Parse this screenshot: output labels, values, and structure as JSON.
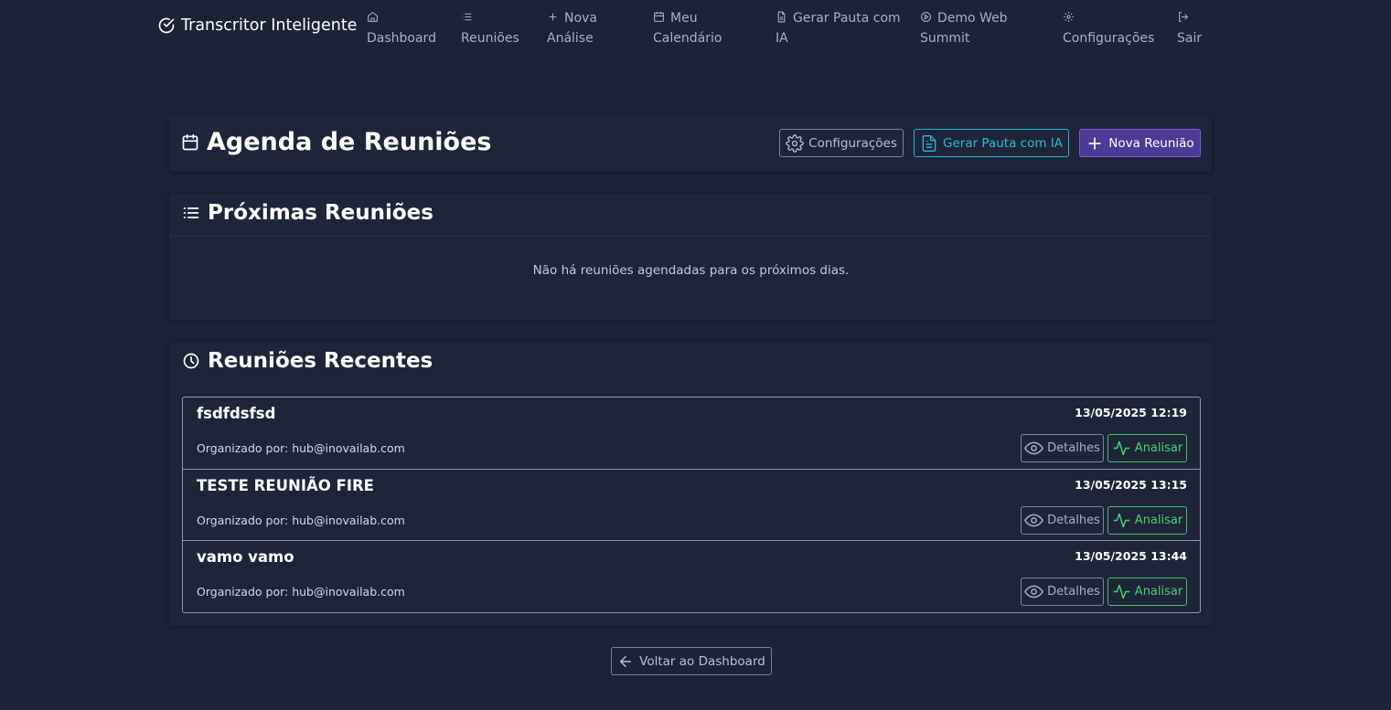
{
  "app": {
    "brand": "Transcritor Inteligente"
  },
  "nav": {
    "items": [
      {
        "line1": "",
        "line2": "Dashboard",
        "icon": "home-icon"
      },
      {
        "line1": "",
        "line2": "Reuniões",
        "icon": "list-icon"
      },
      {
        "line1": "Nova",
        "line2": "Análise",
        "icon": "plus-icon"
      },
      {
        "line1": "Meu",
        "line2": "Calendário",
        "icon": "calendar-icon"
      },
      {
        "line1": "Gerar Pauta com",
        "line2": "IA",
        "icon": "document-icon"
      },
      {
        "line1": "Demo Web",
        "line2": "Summit",
        "icon": "play-circle-icon"
      },
      {
        "line1": "",
        "line2": "Configurações",
        "icon": "gear-icon"
      },
      {
        "line1": "",
        "line2": "Sair",
        "icon": "logout-icon"
      }
    ]
  },
  "header": {
    "title": "Agenda de Reuniões",
    "buttons": {
      "config": "Configurações",
      "pauta": "Gerar Pauta com IA",
      "nova": "Nova Reunião"
    }
  },
  "upcoming": {
    "title": "Próximas Reuniões",
    "empty_message": "Não há reuniões agendadas para os próximos dias."
  },
  "recent": {
    "title": "Reuniões Recentes",
    "details_label": "Detalhes",
    "analyze_label": "Analisar",
    "meetings": [
      {
        "title": "fsdfdsfsd",
        "datetime": "13/05/2025 12:19",
        "organizer": "Organizado por: hub@inovailab.com"
      },
      {
        "title": "TESTE REUNIÃO FIRE",
        "datetime": "13/05/2025 13:15",
        "organizer": "Organizado por: hub@inovailab.com"
      },
      {
        "title": "vamo vamo",
        "datetime": "13/05/2025 13:44",
        "organizer": "Organizado por: hub@inovailab.com"
      }
    ]
  },
  "footer": {
    "back_label": "Voltar ao Dashboard"
  },
  "colors": {
    "background": "#1c2334",
    "card": "#1e2538",
    "accent_cyan": "#28b9d6",
    "accent_purple": "#4c3a96",
    "accent_green": "#49d06f"
  }
}
